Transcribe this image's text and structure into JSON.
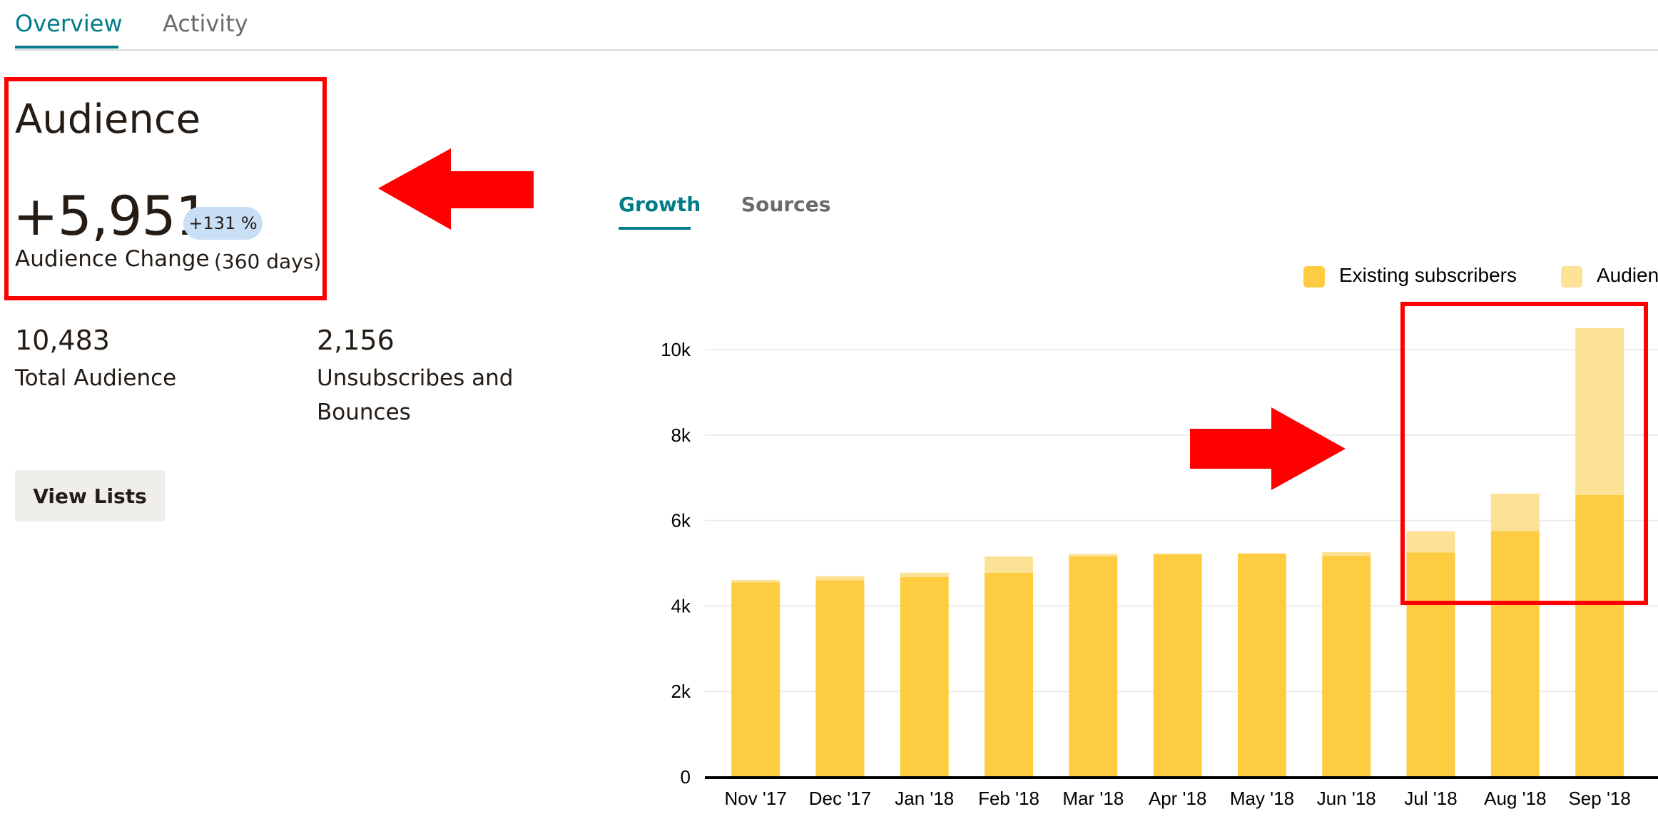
{
  "tabs": {
    "overview": "Overview",
    "activity": "Activity"
  },
  "audience": {
    "title": "Audience",
    "change_value": "+5,951",
    "change_percent": "+131 %",
    "change_label": "Audience Change",
    "change_period": "(360 days)"
  },
  "stats": {
    "total_value": "10,483",
    "total_label": "Total Audience",
    "unsub_value": "2,156",
    "unsub_label_line1": "Unsubscribes and",
    "unsub_label_line2": "Bounces"
  },
  "view_lists_button": "View Lists",
  "chart_tabs": {
    "growth": "Growth",
    "sources": "Sources"
  },
  "colors": {
    "accent": "#007c89",
    "existing": "#fdcc40",
    "new": "#fde295",
    "annotation_red": "#ff0000",
    "badge": "#c8dff5"
  },
  "chart_data": {
    "type": "bar",
    "stacked": true,
    "categories": [
      "Nov '17",
      "Dec '17",
      "Jan '18",
      "Feb '18",
      "Mar '18",
      "Apr '18",
      "May '18",
      "Jun '18",
      "Jul '18",
      "Aug '18",
      "Sep '18"
    ],
    "series": [
      {
        "name": "Existing subscribers",
        "color": "#fdcc40",
        "values": [
          4550,
          4600,
          4680,
          4780,
          5160,
          5210,
          5220,
          5180,
          5250,
          5750,
          6600
        ]
      },
      {
        "name": "Audien",
        "color": "#fde295",
        "values": [
          60,
          100,
          100,
          380,
          60,
          20,
          20,
          80,
          500,
          880,
          3900
        ]
      }
    ],
    "yticks": [
      "0",
      "2k",
      "4k",
      "6k",
      "8k",
      "10k"
    ],
    "ylim": [
      0,
      10000
    ],
    "grid": true,
    "legend_position": "top-right"
  }
}
